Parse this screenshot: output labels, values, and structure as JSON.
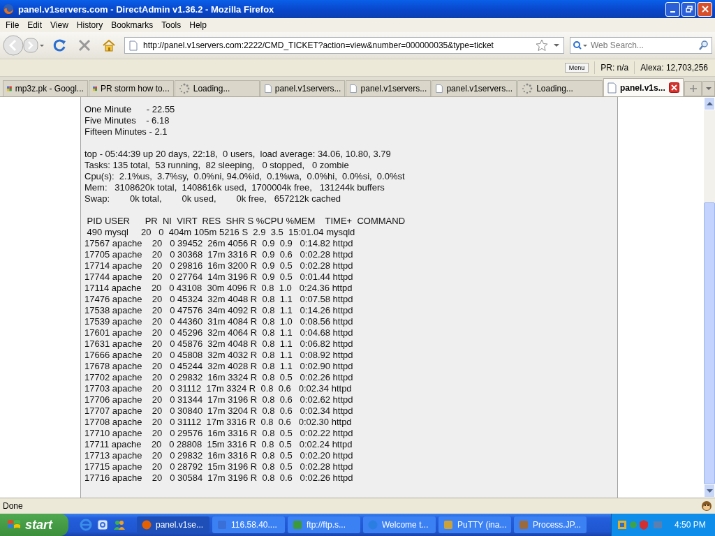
{
  "window": {
    "title": "panel.v1servers.com - DirectAdmin v1.36.2 - Mozilla Firefox"
  },
  "menu": [
    "File",
    "Edit",
    "View",
    "History",
    "Bookmarks",
    "Tools",
    "Help"
  ],
  "toolbar": {
    "url": "http://panel.v1servers.com:2222/CMD_TICKET?action=view&number=000000035&type=ticket",
    "search_placeholder": "Web Search..."
  },
  "addon_bar": {
    "menu_button": "Menu",
    "pr": "PR: n/a",
    "alexa": "Alexa: 12,703,256"
  },
  "tabs": [
    {
      "label": "mp3z.pk - Googl...",
      "kind": "google",
      "selected": false
    },
    {
      "label": "PR storm how to...",
      "kind": "google",
      "selected": false
    },
    {
      "label": "Loading...",
      "kind": "loading",
      "selected": false
    },
    {
      "label": "panel.v1servers...",
      "kind": "page",
      "selected": false
    },
    {
      "label": "panel.v1servers...",
      "kind": "page",
      "selected": false
    },
    {
      "label": "panel.v1servers...",
      "kind": "page",
      "selected": false
    },
    {
      "label": "Loading...",
      "kind": "loading",
      "selected": false
    },
    {
      "label": "panel.v1s...",
      "kind": "page",
      "selected": true
    }
  ],
  "content": {
    "sections": [
      [
        "One Minute      - 22.55",
        "Five Minutes    - 6.18",
        "Fifteen Minutes - 2.1"
      ],
      [
        "top - 05:44:39 up 20 days, 22:18,  0 users,  load average: 34.06, 10.80, 3.79",
        "Tasks: 135 total,  53 running,  82 sleeping,   0 stopped,   0 zombie",
        "Cpu(s):  2.1%us,  3.7%sy,  0.0%ni, 94.0%id,  0.1%wa,  0.0%hi,  0.0%si,  0.0%st",
        "Mem:   3108620k total,  1408616k used,  1700004k free,   131244k buffers",
        "Swap:        0k total,        0k used,        0k free,   657212k cached"
      ],
      [
        " PID USER      PR  NI  VIRT  RES  SHR S %CPU %MEM    TIME+  COMMAND",
        " 490 mysql     20   0  404m 105m 5216 S  2.9  3.5  15:01.04 mysqld",
        "17567 apache    20   0 39452  26m 4056 R  0.9  0.9   0:14.82 httpd",
        "17705 apache    20   0 30368  17m 3316 R  0.9  0.6   0:02.28 httpd",
        "17714 apache    20   0 29816  16m 3200 R  0.9  0.5   0:02.28 httpd",
        "17744 apache    20   0 27764  14m 3196 R  0.9  0.5   0:01.44 httpd",
        "17114 apache    20   0 43108  30m 4096 R  0.8  1.0   0:24.36 httpd",
        "17476 apache    20   0 45324  32m 4048 R  0.8  1.1   0:07.58 httpd",
        "17538 apache    20   0 47576  34m 4092 R  0.8  1.1   0:14.26 httpd",
        "17539 apache    20   0 44360  31m 4084 R  0.8  1.0   0:08.56 httpd",
        "17601 apache    20   0 45296  32m 4064 R  0.8  1.1   0:04.68 httpd",
        "17631 apache    20   0 45876  32m 4048 R  0.8  1.1   0:06.82 httpd",
        "17666 apache    20   0 45808  32m 4032 R  0.8  1.1   0:08.92 httpd",
        "17678 apache    20   0 45244  32m 4028 R  0.8  1.1   0:02.90 httpd",
        "17702 apache    20   0 29832  16m 3324 R  0.8  0.5   0:02.26 httpd",
        "17703 apache    20   0 31112  17m 3324 R  0.8  0.6   0:02.34 httpd",
        "17706 apache    20   0 31344  17m 3196 R  0.8  0.6   0:02.62 httpd",
        "17707 apache    20   0 30840  17m 3204 R  0.8  0.6   0:02.34 httpd",
        "17708 apache    20   0 31112  17m 3316 R  0.8  0.6   0:02.30 httpd",
        "17710 apache    20   0 29576  16m 3316 R  0.8  0.5   0:02.22 httpd",
        "17711 apache    20   0 28808  15m 3316 R  0.8  0.5   0:02.24 httpd",
        "17713 apache    20   0 29832  16m 3316 R  0.8  0.5   0:02.20 httpd",
        "17715 apache    20   0 28792  15m 3196 R  0.8  0.5   0:02.28 httpd",
        "17716 apache    20   0 30584  17m 3196 R  0.8  0.6   0:02.26 httpd"
      ]
    ]
  },
  "status_bar": {
    "text": "Done"
  },
  "taskbar": {
    "start": "start",
    "tasks": [
      {
        "label": "panel.v1se...",
        "kind": "firefox",
        "selected": true
      },
      {
        "label": "116.58.40....",
        "kind": "remote",
        "selected": false
      },
      {
        "label": "ftp://ftp.s...",
        "kind": "ftp",
        "selected": false
      },
      {
        "label": "Welcome t...",
        "kind": "ie",
        "selected": false
      },
      {
        "label": "PuTTY (ina...",
        "kind": "putty",
        "selected": false
      },
      {
        "label": "Process.JP...",
        "kind": "app",
        "selected": false
      }
    ],
    "clock": "4:50 PM"
  }
}
